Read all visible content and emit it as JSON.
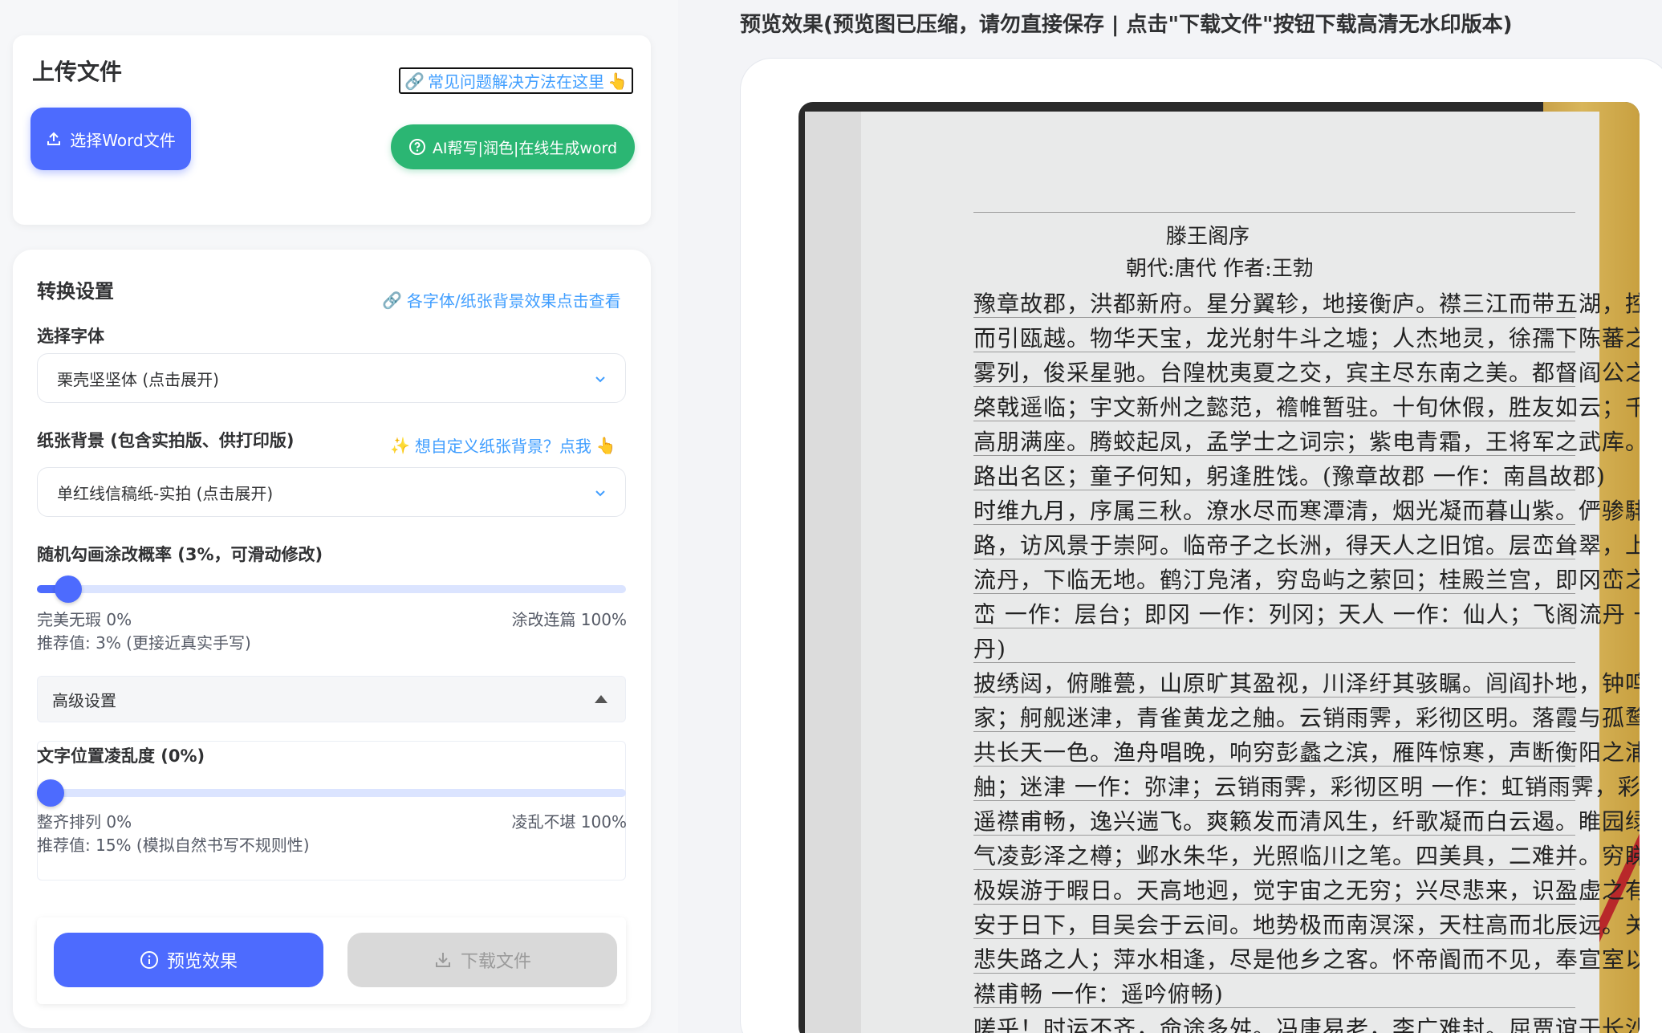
{
  "upload": {
    "title": "上传文件",
    "faq_link": "常见问题解决方法在这里",
    "select_button": "选择Word文件",
    "ai_button": "AI帮写|润色|在线生成word"
  },
  "settings": {
    "title": "转换设置",
    "font_effects_link": "各字体/纸张背景效果点击查看",
    "font": {
      "label": "选择字体",
      "value": "栗壳坚坚体 (点击展开)"
    },
    "paper": {
      "label": "纸张背景 (包含实拍版、供打印版)",
      "custom_link": "想自定义纸张背景？点我",
      "value": "单红线信稿纸-实拍 (点击展开)"
    },
    "scribble": {
      "label": "随机勾画涂改概率 (3%，可滑动修改)",
      "value_percent": 3,
      "min_label": "完美无瑕 0%",
      "max_label": "涂改连篇 100%",
      "recommend": "推荐值: 3% (更接近真实手写)"
    },
    "advanced": {
      "label": "高级设置"
    },
    "jitter": {
      "label": "文字位置凌乱度 (0%)",
      "value_percent": 0,
      "min_label": "整齐排列 0%",
      "max_label": "凌乱不堪 100%",
      "recommend": "推荐值: 15% (模拟自然书写不规则性)"
    },
    "preview_button": "预览效果",
    "download_button": "下载文件"
  },
  "preview": {
    "title": "预览效果(预览图已压缩，请勿直接保存 | 点击\"下载文件\"按钮下载高清无水印版本)",
    "doc_title": "滕王阁序",
    "doc_byline": "朝代:唐代 作者:王勃",
    "lines": [
      "豫章故郡，洪都新府。星分翼轸，地接衡庐。襟三江而带五湖，控蛮荆",
      "而引瓯越。物华天宝，龙光射牛斗之墟；人杰地灵，徐孺下陈蕃之榻。雄州",
      "雾列，俊采星驰。台隍枕夷夏之交，宾主尽东南之美。都督阎公之雅望，",
      "棨戟遥临；宇文新州之懿范，襜帷暂驻。十旬休假，胜友如云；千里逢迎，",
      "高朋满座。腾蛟起凤，孟学士之词宗；紫电青霜，王将军之武库。家君作宰，",
      "路出名区；童子何知，躬逢胜饯。(豫章故郡 一作：南昌故郡)",
      "时维九月，序属三秋。潦水尽而寒潭清，烟光凝而暮山紫。俨骖騑于上",
      "路，访风景于崇阿。临帝子之长洲，得天人之旧馆。层峦耸翠，上出重霄；飞阁",
      "流丹，下临无地。鹤汀凫渚，穷岛屿之萦回；桂殿兰宫，即冈峦之体势。(层",
      "峦 一作：层台；即冈 一作：列冈；天人 一作：仙人；飞阁流丹 一作：飞阁翔",
      "丹)",
      "披绣闼，俯雕甍，山原旷其盈视，川泽纡其骇瞩。闾阎扑地，钟鸣鼎食之",
      "家；舸舰迷津，青雀黄龙之舳。云销雨霁，彩彻区明。落霞与孤鹜齐飞，秋水",
      "共长天一色。渔舟唱晚，响穷彭蠡之滨，雁阵惊寒，声断衡阳之浦。(轴 通：",
      "舳；迷津 一作：弥津；云销雨霁，彩彻区明 一作：虹销雨霁，彩彻云衢)",
      "遥襟甫畅，逸兴遄飞。爽籁发而清风生，纤歌凝而白云遏。睢园绿竹，",
      "气凌彭泽之樽；邺水朱华，光照临川之笔。四美具，二难并。穷睇眄于中天，",
      "极娱游于暇日。天高地迥，觉宇宙之无穷；兴尽悲来，识盈虚之有数。望长",
      "安于日下，目吴会于云间。地势极而南溟深，天柱高而北辰远。关山难越，谁",
      "悲失路之人；萍水相逢，尽是他乡之客。怀帝阍而不见，奉宣室以何年？(遥",
      "襟甫畅 一作：遥吟俯畅)",
      "嗟乎！时运不齐，命途多舛。冯唐易老，李广难封。屈贾谊于长沙，非无圣主"
    ]
  },
  "colors": {
    "primary": "#4d6bfe",
    "success": "#2bb673",
    "link": "#409eff",
    "disabled": "#d9d9d9"
  }
}
